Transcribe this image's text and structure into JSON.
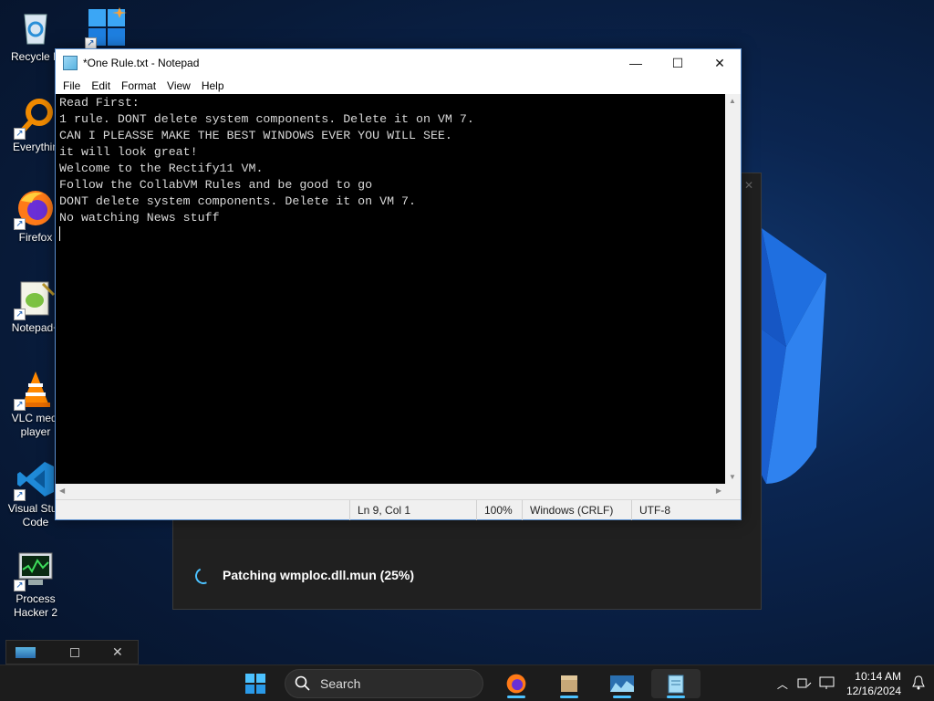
{
  "desktop": {
    "icons": [
      {
        "label": "Recycle B",
        "icon": "recycle-bin-icon"
      },
      {
        "label": "",
        "icon": "windows-app-icon"
      },
      {
        "label": "Everythin",
        "icon": "everything-search-icon"
      },
      {
        "label": "Firefox",
        "icon": "firefox-icon"
      },
      {
        "label": "Notepad+",
        "icon": "notepad-plus-plus-icon"
      },
      {
        "label": "VLC medi",
        "label2": "player",
        "icon": "vlc-icon"
      },
      {
        "label": "Visual Stud",
        "label2": "Code",
        "icon": "vscode-icon"
      },
      {
        "label": "Process",
        "label2": "Hacker 2",
        "icon": "process-hacker-icon"
      }
    ]
  },
  "patch_dialog": {
    "status_text": "Patching wmploc.dll.mun (25%)",
    "progress_percent": 25
  },
  "notepad": {
    "title": "*One Rule.txt - Notepad",
    "menu": [
      "File",
      "Edit",
      "Format",
      "View",
      "Help"
    ],
    "lines": [
      "Read First:",
      "1 rule. DONT delete system components. Delete it on VM 7.",
      "CAN I PLEASSE MAKE THE BEST WINDOWS EVER YOU WILL SEE.",
      "it will look great!",
      "Welcome to the Rectify11 VM.",
      "Follow the CollabVM Rules and be good to go",
      "DONT delete system components. Delete it on VM 7.",
      "No watching News stuff",
      ""
    ],
    "status": {
      "position": "Ln 9, Col 1",
      "zoom": "100%",
      "line_ending": "Windows (CRLF)",
      "encoding": "UTF-8"
    }
  },
  "taskbar": {
    "search_placeholder": "Search",
    "time": "10:14 AM",
    "date": "12/16/2024",
    "colors": {
      "accent": "#4cc2ff",
      "background": "#1c1c1c"
    }
  }
}
